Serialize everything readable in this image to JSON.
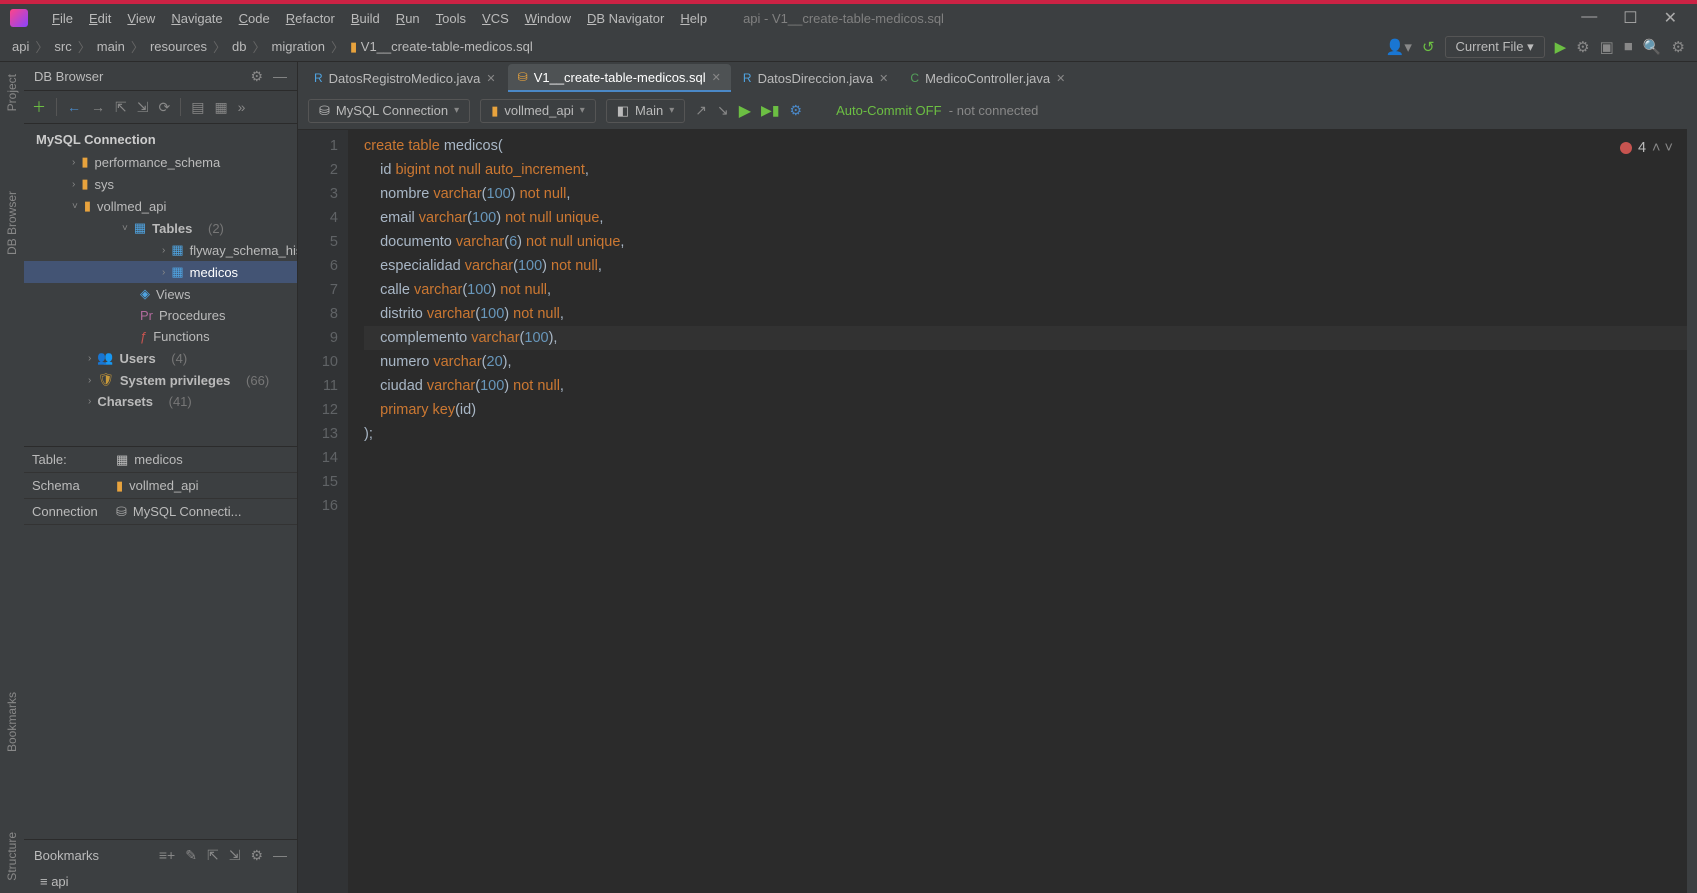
{
  "menu": [
    "File",
    "Edit",
    "View",
    "Navigate",
    "Code",
    "Refactor",
    "Build",
    "Run",
    "Tools",
    "VCS",
    "Window",
    "DB Navigator",
    "Help"
  ],
  "window_title": "api - V1__create-table-medicos.sql",
  "breadcrumb": [
    "api",
    "src",
    "main",
    "resources",
    "db",
    "migration",
    "V1__create-table-medicos.sql"
  ],
  "current_file_btn": "Current File",
  "left_rails": [
    "Project",
    "DB Browser",
    "Bookmarks",
    "Structure"
  ],
  "db_browser_title": "DB Browser",
  "tree": {
    "connection": "MySQL Connection",
    "schemas": [
      {
        "name": "performance_schema"
      },
      {
        "name": "sys"
      },
      {
        "name": "vollmed_api",
        "expanded": true,
        "tables": {
          "label": "Tables",
          "count": "(2)",
          "items": [
            "flyway_schema_history",
            "medicos"
          ]
        },
        "views": "Views",
        "procedures": "Procedures",
        "functions": "Functions"
      }
    ],
    "users": {
      "label": "Users",
      "count": "(4)"
    },
    "sysprivs": {
      "label": "System privileges",
      "count": "(66)"
    },
    "charsets": {
      "label": "Charsets",
      "count": "(41)"
    }
  },
  "detail": {
    "table_k": "Table:",
    "table_v": "medicos",
    "schema_k": "Schema",
    "schema_v": "vollmed_api",
    "conn_k": "Connection",
    "conn_v": "MySQL Connecti..."
  },
  "bookmarks": {
    "title": "Bookmarks",
    "item": "api"
  },
  "tabs": [
    {
      "name": "DatosRegistroMedico.java",
      "icon": "R",
      "color": "#4fa3e0"
    },
    {
      "name": "V1__create-table-medicos.sql",
      "icon": "⛁",
      "color": "#e8a33d",
      "active": true
    },
    {
      "name": "DatosDireccion.java",
      "icon": "R",
      "color": "#4fa3e0"
    },
    {
      "name": "MedicoController.java",
      "icon": "C",
      "color": "#53a05a"
    }
  ],
  "sql_toolbar": {
    "connection": "MySQL Connection",
    "schema": "vollmed_api",
    "target": "Main",
    "auto_commit": "Auto-Commit OFF",
    "status": "- not connected"
  },
  "errors": "4",
  "code": {
    "lines": [
      {
        "n": 1,
        "t": ""
      },
      {
        "n": 2,
        "t": "create table medicos("
      },
      {
        "n": 3,
        "t": ""
      },
      {
        "n": 4,
        "t": "    id bigint not null auto_increment,"
      },
      {
        "n": 5,
        "t": "    nombre varchar(100) not null,"
      },
      {
        "n": 6,
        "t": "    email varchar(100) not null unique,"
      },
      {
        "n": 7,
        "t": "    documento varchar(6) not null unique,"
      },
      {
        "n": 8,
        "t": "    especialidad varchar(100) not null,"
      },
      {
        "n": 9,
        "t": "    calle varchar(100) not null,"
      },
      {
        "n": 10,
        "t": "    distrito varchar(100) not null,"
      },
      {
        "n": 11,
        "t": "    complemento varchar(100),",
        "cursor": true
      },
      {
        "n": 12,
        "t": "    numero varchar(20),"
      },
      {
        "n": 13,
        "t": "    ciudad varchar(100) not null,"
      },
      {
        "n": 14,
        "t": ""
      },
      {
        "n": 15,
        "t": "    primary key(id)"
      },
      {
        "n": 16,
        "t": ");"
      }
    ]
  }
}
